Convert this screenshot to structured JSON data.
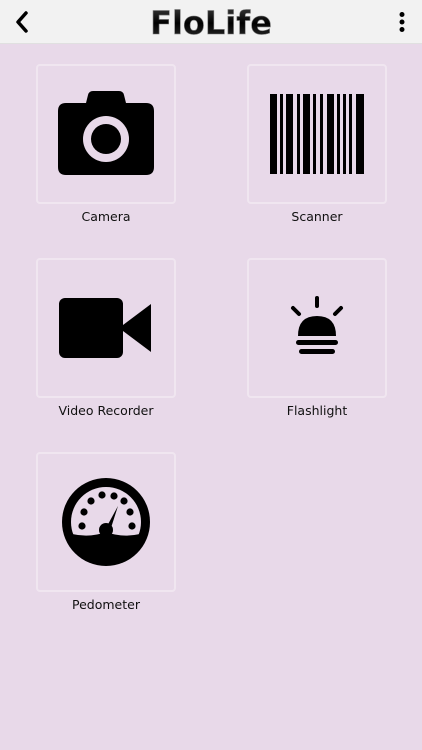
{
  "header": {
    "logo_text": "FloLife",
    "back_icon": "chevron-left-icon",
    "menu_icon": "more-vertical-icon"
  },
  "tiles": [
    {
      "label": "Camera",
      "icon": "camera-icon"
    },
    {
      "label": "Scanner",
      "icon": "barcode-icon"
    },
    {
      "label": "Video Recorder",
      "icon": "video-camera-icon"
    },
    {
      "label": "Flashlight",
      "icon": "flashlight-icon"
    },
    {
      "label": "Pedometer",
      "icon": "speedometer-icon"
    }
  ],
  "colors": {
    "background": "#e8d9e9",
    "topbar": "#f2f2f2",
    "icon": "#000000"
  }
}
